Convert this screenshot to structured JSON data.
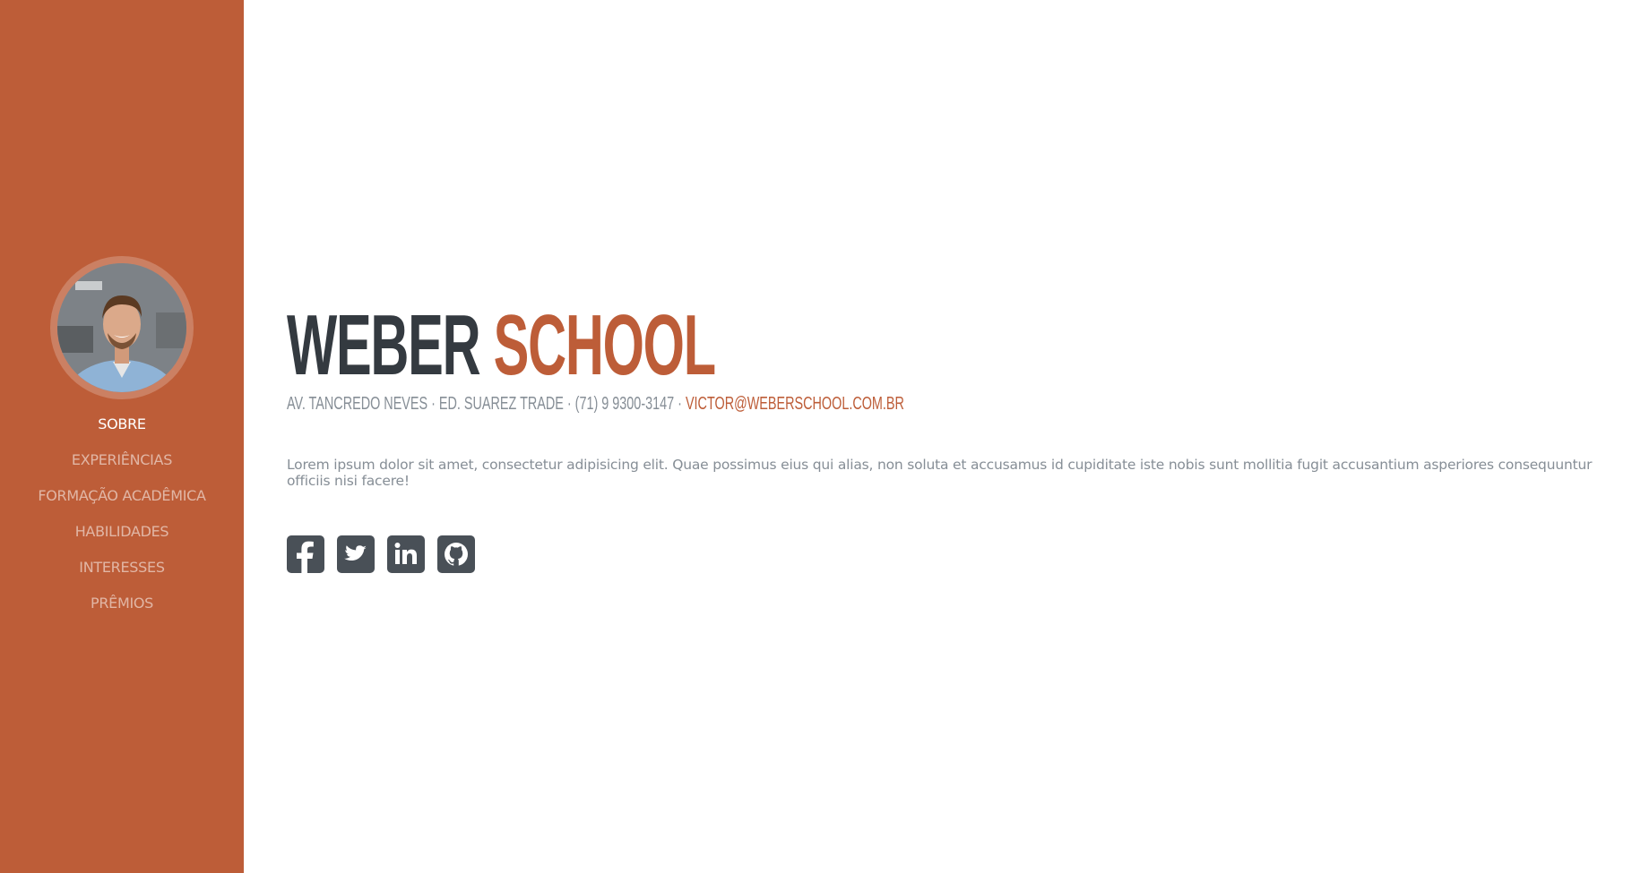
{
  "sidebar": {
    "nav": [
      {
        "label": "SOBRE",
        "active": true
      },
      {
        "label": "EXPERIÊNCIAS",
        "active": false
      },
      {
        "label": "FORMAÇÃO ACADÊMICA",
        "active": false
      },
      {
        "label": "HABILIDADES",
        "active": false
      },
      {
        "label": "INTERESSES",
        "active": false
      },
      {
        "label": "PRÊMIOS",
        "active": false
      }
    ]
  },
  "main": {
    "title_first": "WEBER",
    "title_second": "SCHOOL",
    "address": "AV. TANCREDO NEVES · ED. SUAREZ TRADE · (71) 9 9300-3147 ·",
    "email": "VICTOR@WEBERSCHOOL.COM.BR",
    "bio": "Lorem ipsum dolor sit amet, consectetur adipisicing elit. Quae possimus eius qui alias, non soluta et accusamus id cupiditate iste nobis sunt mollitia fugit accusantium asperiores consequuntur officiis nisi facere!",
    "social": [
      "facebook-icon",
      "twitter-icon",
      "linkedin-icon",
      "github-icon"
    ]
  },
  "colors": {
    "primary": "#bd5d38",
    "dark": "#343a40",
    "muted": "#868e96",
    "icon_bg": "#495057"
  }
}
